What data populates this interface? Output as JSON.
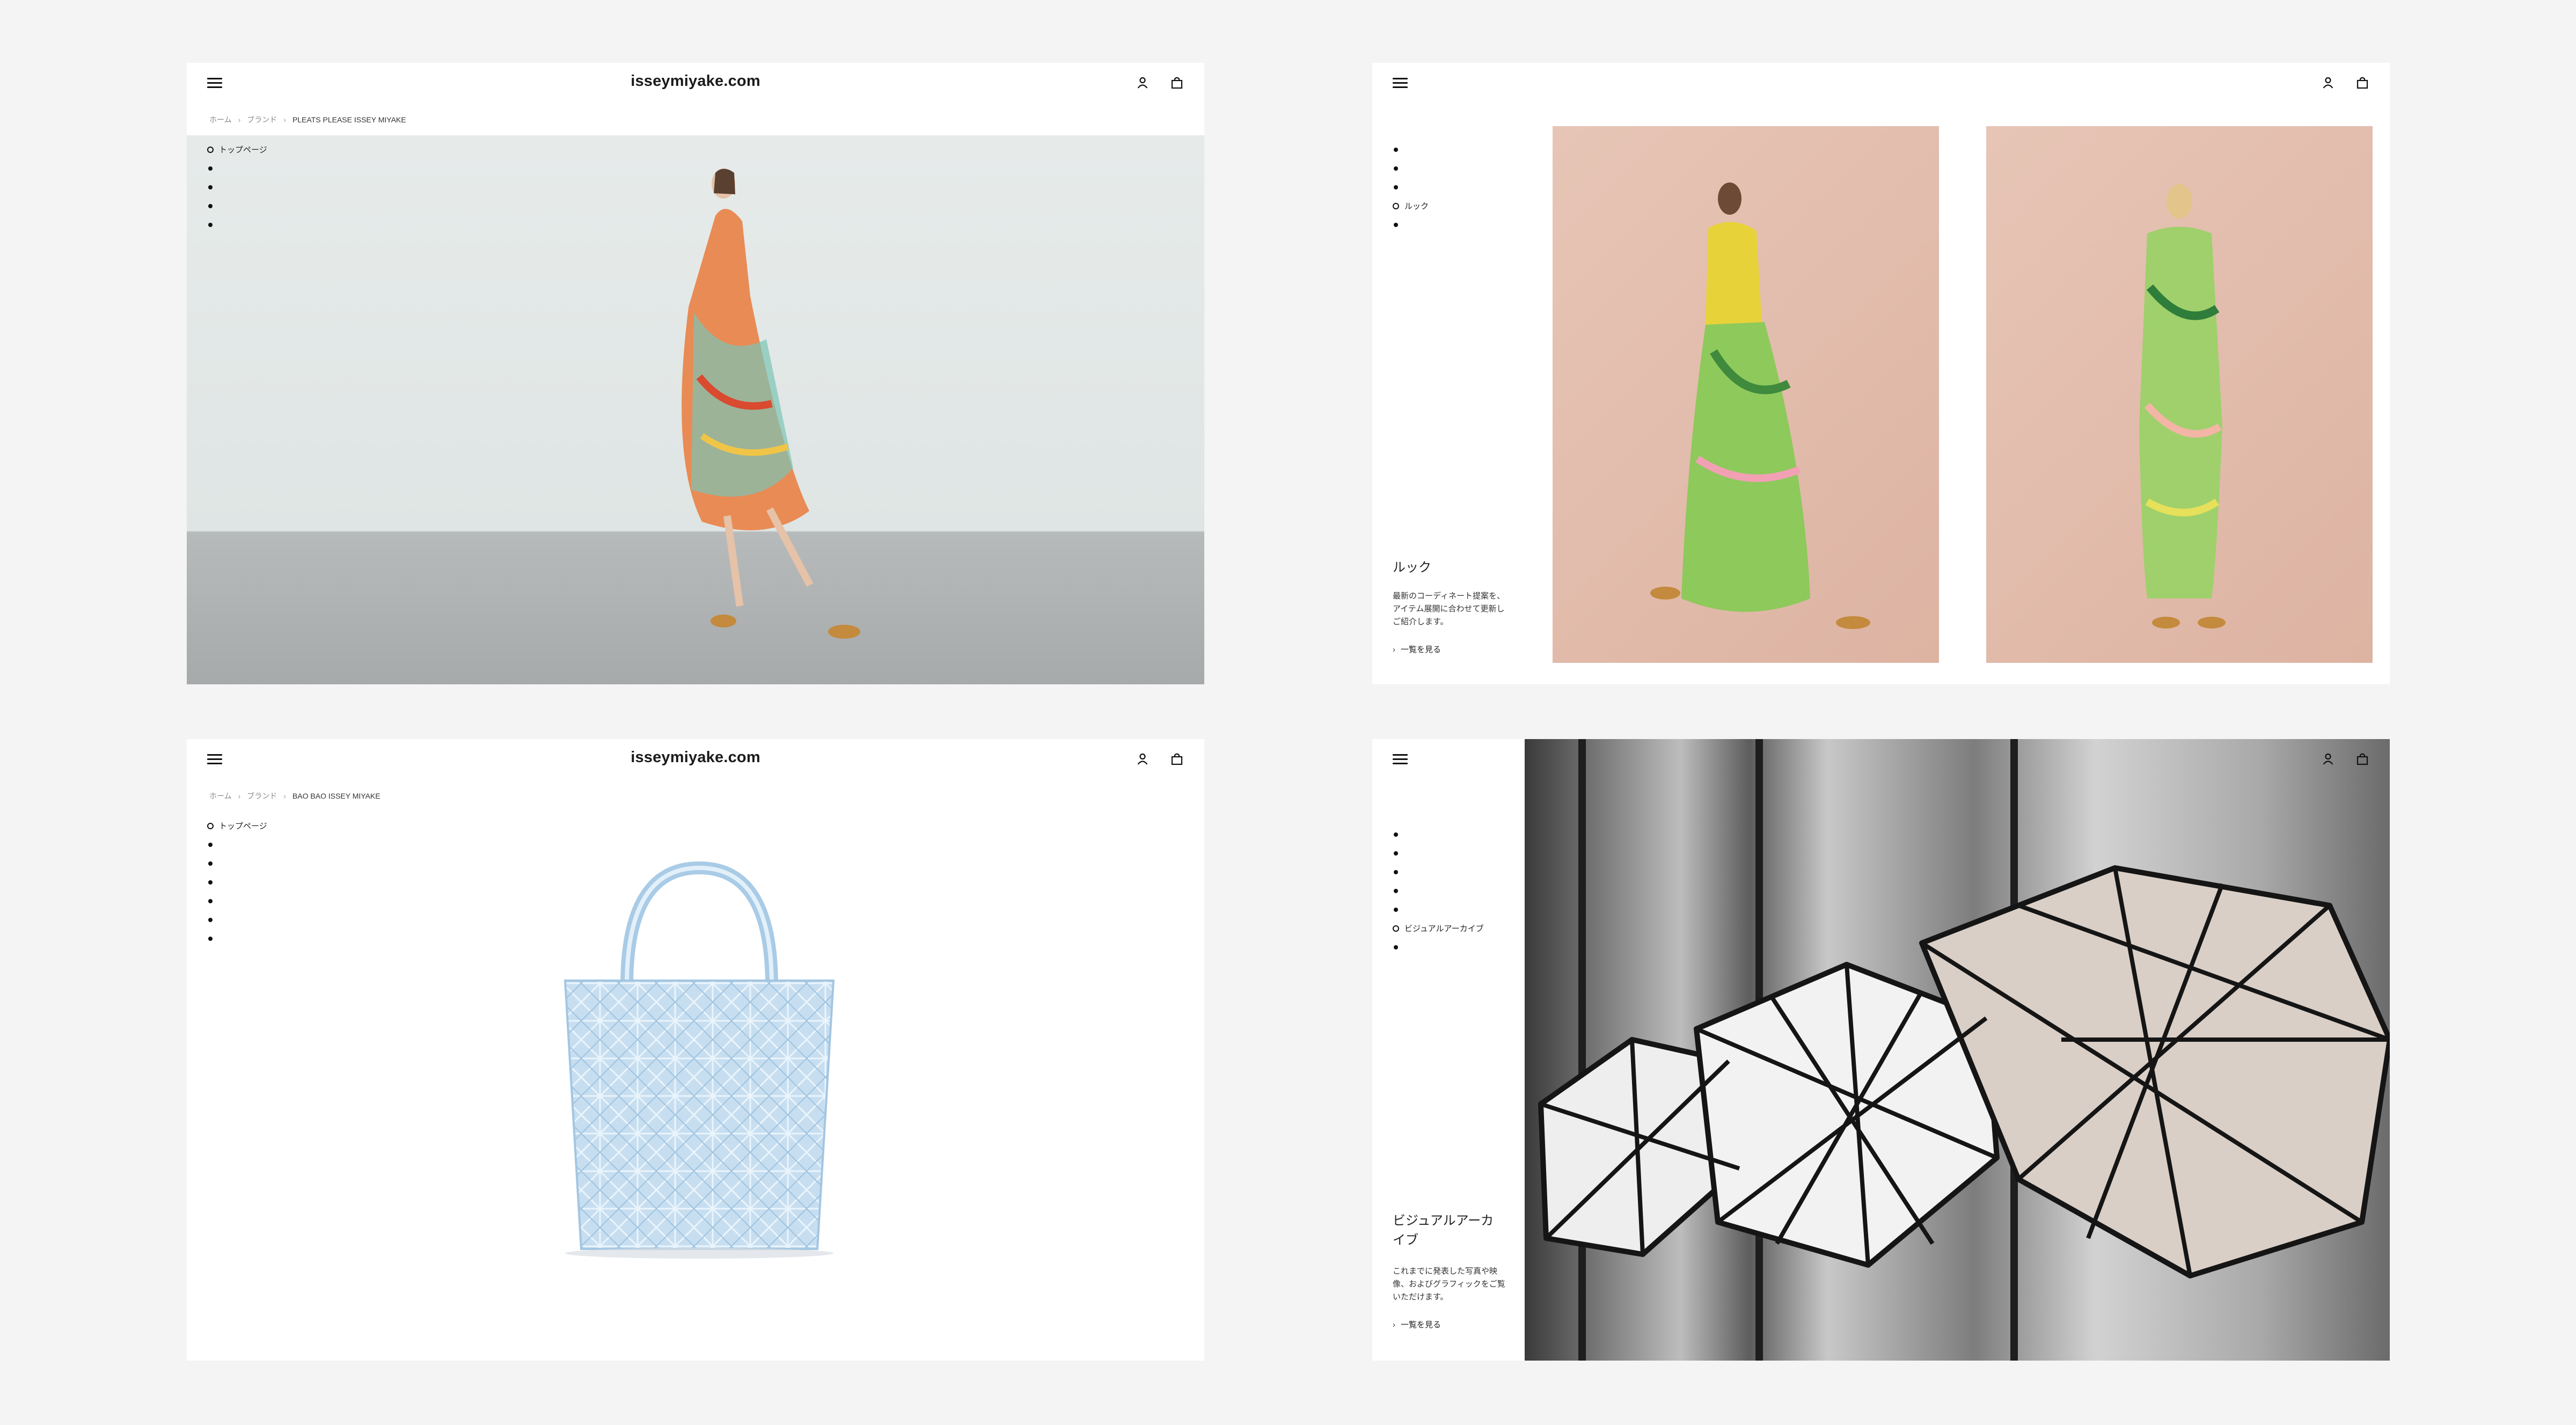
{
  "site": {
    "logo": "isseymiyake.com"
  },
  "panel_pleats": {
    "breadcrumb": [
      "ホーム",
      "ブランド",
      "PLEATS PLEASE ISSEY MIYAKE"
    ],
    "nav_active_label": "トップページ",
    "nav_bullet_count": 4
  },
  "panel_look": {
    "nav_active_label": "ルック",
    "title": "ルック",
    "description": "最新のコーディネート提案を、アイテム展開に合わせて更新しご紹介します。",
    "link": "一覧を見る"
  },
  "panel_baobao": {
    "breadcrumb": [
      "ホーム",
      "ブランド",
      "BAO BAO ISSEY MIYAKE"
    ],
    "nav_active_label": "トップページ"
  },
  "panel_archive": {
    "nav_active_label": "ビジュアルアーカイブ",
    "title": "ビジュアルアーカイブ",
    "description": "これまでに発表した写真や映像、およびグラフィックをご覧いただけます。",
    "link": "一覧を見る"
  },
  "icons": {
    "menu": "hamburger-menu-icon",
    "account": "user-icon",
    "cart": "shopping-bag-icon",
    "breadcrumb_separator": "chevron-right-icon",
    "link_arrow": "chevron-right-icon"
  },
  "colors": {
    "page_background": "#f4f4f4",
    "panel_background": "#ffffff",
    "text": "#1a1a1a"
  }
}
